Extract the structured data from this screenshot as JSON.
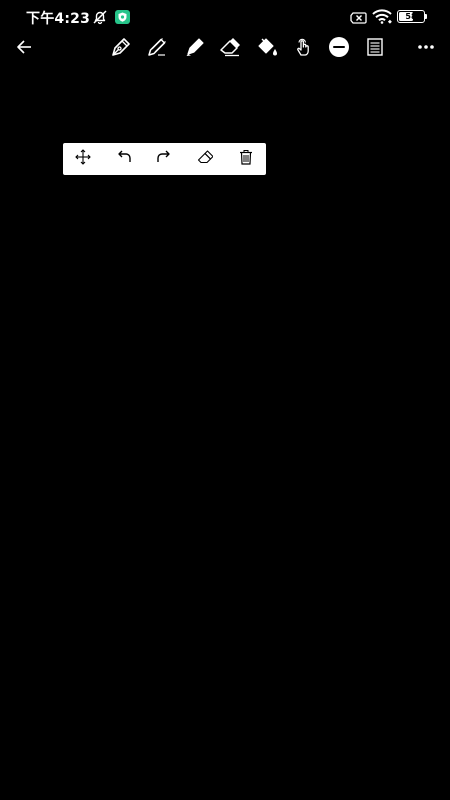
{
  "status_bar": {
    "time": "下午4:23",
    "battery_level": "58",
    "battery_fraction": 0.58,
    "icons": [
      "alarm-off-icon",
      "shield-app-icon",
      "no-sim-icon",
      "wifi-icon",
      "battery-icon"
    ],
    "accent_color": "#27c48a"
  },
  "toolbar": {
    "items": [
      "back-arrow-icon",
      "pen-icon",
      "pencil-icon",
      "marker-icon",
      "eraser-icon",
      "fill-bucket-icon",
      "hand-touch-icon",
      "color-swatch",
      "page-icon",
      "more-icon"
    ],
    "selected_color": "#ffffff"
  },
  "edit_bar": {
    "items": [
      "move-icon",
      "undo-icon",
      "redo-icon",
      "eraser-icon",
      "trash-icon"
    ],
    "background": "#ffffff"
  },
  "canvas": {
    "background": "#000000"
  }
}
